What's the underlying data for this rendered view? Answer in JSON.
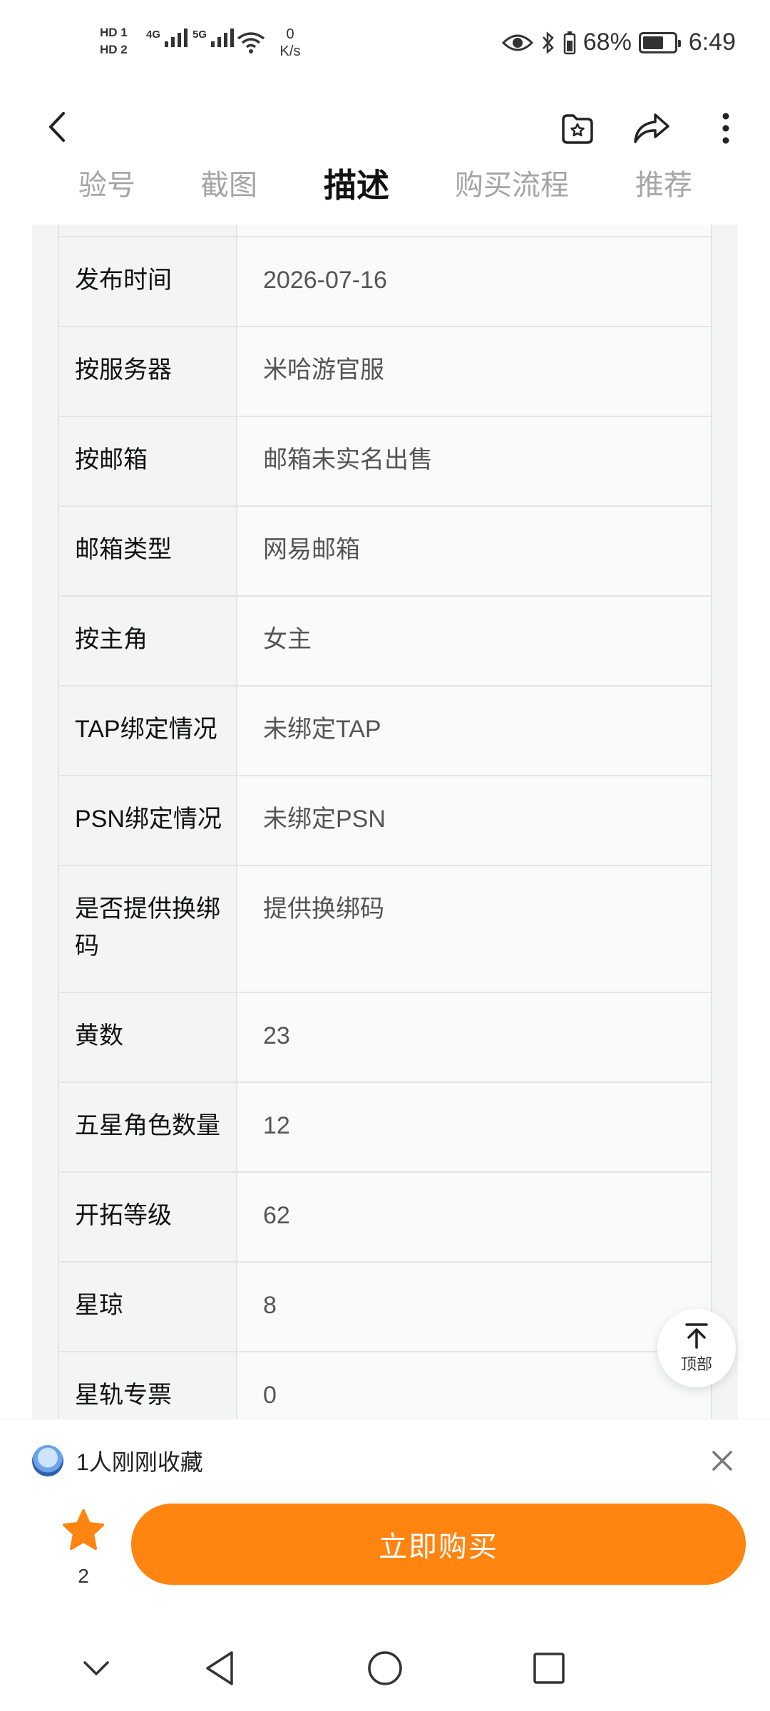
{
  "status_bar": {
    "hd1": "HD 1",
    "hd2": "HD 2",
    "sig1_label": "4G",
    "sig2_label": "5G",
    "speed_value": "0",
    "speed_unit": "K/s",
    "battery": "68%",
    "time": "6:49"
  },
  "header": {
    "tabs": [
      "验号",
      "截图",
      "描述",
      "购买流程",
      "推荐"
    ],
    "active_tab": "描述"
  },
  "table": {
    "rows": [
      {
        "key": "发布时间",
        "value": "2026-07-16"
      },
      {
        "key": "按服务器",
        "value": "米哈游官服"
      },
      {
        "key": "按邮箱",
        "value": "邮箱未实名出售"
      },
      {
        "key": "邮箱类型",
        "value": "网易邮箱"
      },
      {
        "key": "按主角",
        "value": "女主"
      },
      {
        "key": "TAP绑定情况",
        "value": "未绑定TAP"
      },
      {
        "key": "PSN绑定情况",
        "value": "未绑定PSN"
      },
      {
        "key": "是否提供换绑码",
        "value": "提供换绑码"
      },
      {
        "key": "黄数",
        "value": "23"
      },
      {
        "key": "五星角色数量",
        "value": "12"
      },
      {
        "key": "开拓等级",
        "value": "62"
      },
      {
        "key": "星琼",
        "value": "8"
      },
      {
        "key": "星轨专票",
        "value": "0"
      }
    ]
  },
  "top_button": {
    "label": "顶部"
  },
  "bottom": {
    "notice": "1人刚刚收藏",
    "favorite_count": "2",
    "buy_label": "立即购买",
    "accent_color": "#ff8410"
  }
}
